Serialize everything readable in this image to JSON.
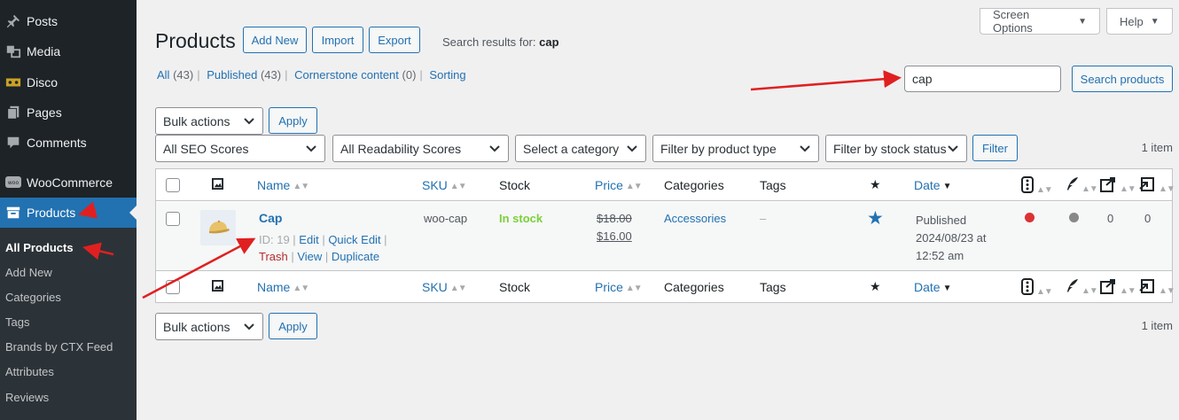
{
  "sidebar": {
    "items": [
      {
        "label": "Posts",
        "icon": "pin-icon"
      },
      {
        "label": "Media",
        "icon": "media-icon"
      },
      {
        "label": "Disco",
        "icon": "ticket-icon"
      },
      {
        "label": "Pages",
        "icon": "pages-icon"
      },
      {
        "label": "Comments",
        "icon": "comment-icon"
      },
      {
        "label": "WooCommerce",
        "icon": "woo-icon"
      },
      {
        "label": "Products",
        "icon": "archive-icon",
        "active": true
      }
    ],
    "submenu": [
      "All Products",
      "Add New",
      "Categories",
      "Tags",
      "Brands by CTX Feed",
      "Attributes",
      "Reviews"
    ]
  },
  "header": {
    "title": "Products",
    "add_new": "Add New",
    "import": "Import",
    "export": "Export",
    "search_results_prefix": "Search results for: ",
    "search_term": "cap",
    "screen_options": "Screen Options",
    "help": "Help"
  },
  "filters_links": {
    "all": "All",
    "all_count": "(43)",
    "published": "Published",
    "published_count": "(43)",
    "cornerstone": "Cornerstone content",
    "cornerstone_count": "(0)",
    "sorting": "Sorting"
  },
  "search": {
    "value": "cap",
    "button": "Search products"
  },
  "bulk": {
    "label": "Bulk actions",
    "apply": "Apply"
  },
  "filters": {
    "seo": "All SEO Scores",
    "readability": "All Readability Scores",
    "category": "Select a category",
    "product_type": "Filter by product type",
    "stock_status": "Filter by stock status",
    "filter_button": "Filter"
  },
  "item_count": "1 item",
  "columns": {
    "name": "Name",
    "sku": "SKU",
    "stock": "Stock",
    "price": "Price",
    "categories": "Categories",
    "tags": "Tags",
    "date": "Date"
  },
  "product": {
    "name": "Cap",
    "id_label": "ID: 19",
    "edit": "Edit",
    "quick_edit": "Quick Edit",
    "trash": "Trash",
    "view": "View",
    "duplicate": "Duplicate",
    "sku": "woo-cap",
    "stock": "In stock",
    "price_regular": "$18.00",
    "price_sale": "$16.00",
    "category": "Accessories",
    "tags": "–",
    "date_status": "Published",
    "date_line": "2024/08/23 at",
    "time": "12:52 am",
    "links_out": "0",
    "links_in": "0",
    "seo_color": "#dc3232",
    "readability_color": "#888888"
  }
}
